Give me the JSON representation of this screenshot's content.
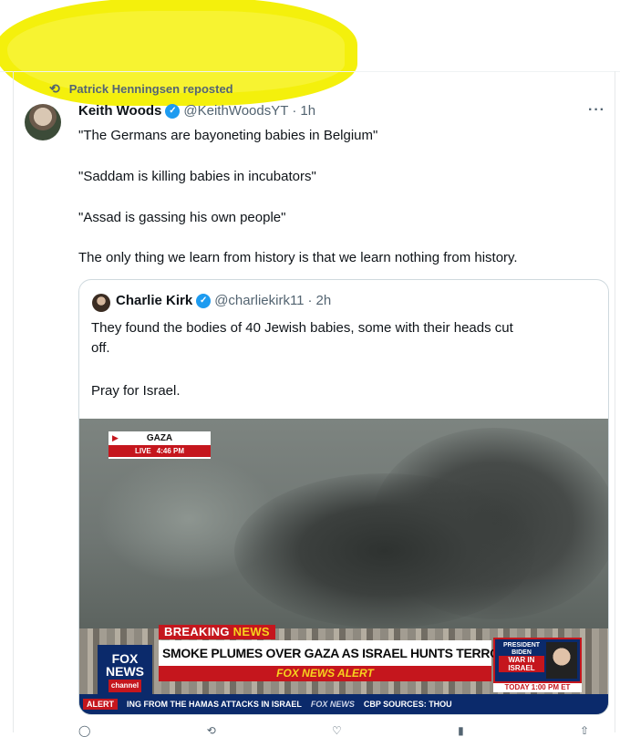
{
  "repost": {
    "label": "Patrick Henningsen reposted"
  },
  "tweet": {
    "name": "Keith Woods",
    "handle": "@KeithWoodsYT",
    "time": "1h",
    "lines": [
      "\"The Germans are bayoneting babies in Belgium\"",
      "\"Saddam is killing babies in incubators\"",
      "\"Assad is gassing his own people\"",
      "The only thing we learn from history is that we learn nothing from history."
    ]
  },
  "quote": {
    "name": "Charlie Kirk",
    "handle": "@charliekirk11",
    "time": "2h",
    "text_line1": "They found the bodies of 40 Jewish babies, some with their heads cut",
    "text_line2": "off.",
    "text_line3": "Pray for Israel."
  },
  "media": {
    "location": "GAZA",
    "live": "LIVE",
    "live_time": "4:46 PM",
    "breaking": "BREAKING",
    "breaking_news": "NEWS",
    "headline": "SMOKE PLUMES OVER GAZA AS ISRAEL HUNTS TERRORISTS",
    "alert_bar": "FOX NEWS ALERT",
    "logo_line1": "FOX",
    "logo_line2": "NEWS",
    "logo_channel": "channel",
    "side_text": "PRESIDENT BIDEN REMARKS ON",
    "side_war": "WAR IN ISRAEL",
    "today": "TODAY 1:00 PM ET",
    "ticker_alert": "ALERT",
    "ticker_text": "ING FROM THE HAMAS ATTACKS IN ISRAEL",
    "ticker_brand": "FOX NEWS",
    "ticker_sources": "CBP SOURCES: THOU"
  },
  "colors": {
    "highlight": "#f4f000",
    "verified": "#1d9bf0",
    "fox_red": "#c5161d",
    "fox_blue": "#0b2a6b"
  }
}
